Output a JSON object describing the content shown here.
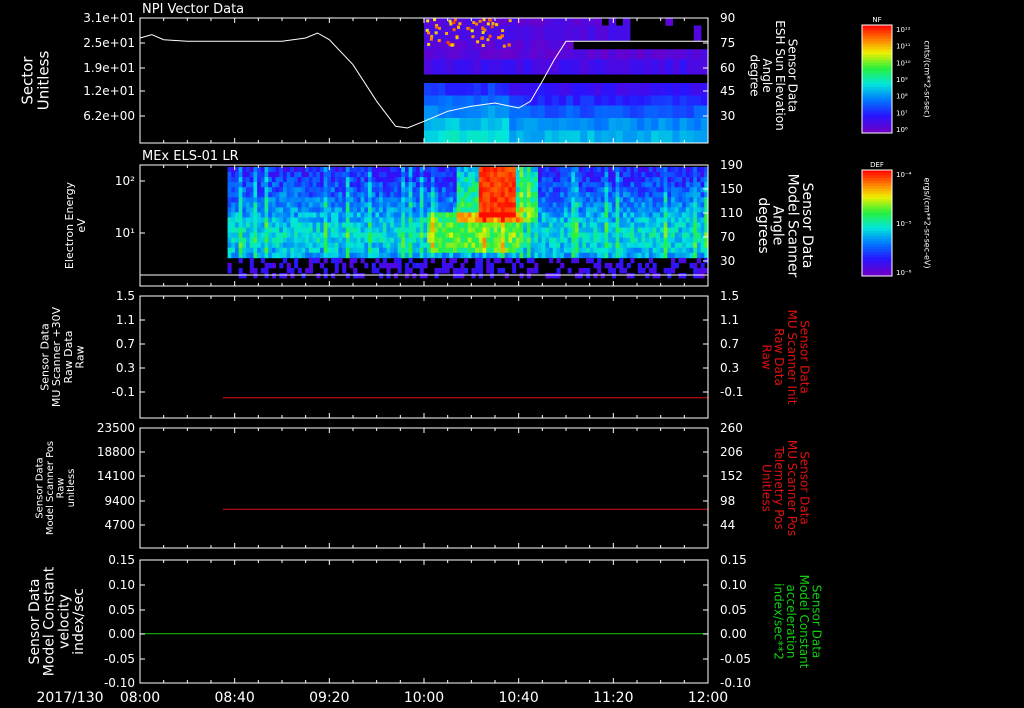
{
  "date_label": "2017/130",
  "time_ticks": [
    "08:00",
    "08:40",
    "09:20",
    "10:00",
    "10:40",
    "11:20",
    "12:00"
  ],
  "colors": {
    "trace_red": "#e01010",
    "trace_green": "#10d010",
    "frame": "#ffffff"
  },
  "chart_data": [
    {
      "type": "heatmap",
      "title": "NPI Vector Data",
      "ylabel": "Sector\nUnitless",
      "yticks": [
        "3.1e+01",
        "2.5e+01",
        "1.9e+01",
        "1.2e+01",
        "6.2e+00"
      ],
      "right_ylabel": "Sensor Data\nESH Sun Elevation\nAngle\ndegree",
      "right_yticks": [
        "90",
        "75",
        "60",
        "45",
        "30"
      ],
      "right_ylim": [
        15,
        90
      ],
      "colorbar": {
        "label": "NF",
        "units": "cnts/(cm**2-sr-sec)",
        "ticks": [
          "10¹²",
          "10¹¹",
          "10¹⁰",
          "10⁹",
          "10⁸",
          "10⁷",
          "10⁶"
        ]
      },
      "data_start": "10:00",
      "overlay_line": {
        "name": "ESH Sun Elevation Angle",
        "x": [
          "08:00",
          "08:05",
          "08:10",
          "08:20",
          "09:00",
          "09:10",
          "09:15",
          "09:20",
          "09:30",
          "09:40",
          "09:48",
          "09:53",
          "10:00",
          "10:10",
          "10:20",
          "10:30",
          "10:40",
          "10:45",
          "10:50",
          "10:55",
          "11:00",
          "11:20",
          "12:00"
        ],
        "y": [
          78,
          80,
          77,
          76,
          76,
          78,
          81,
          77,
          62,
          40,
          25,
          24,
          28,
          34,
          37,
          39,
          36,
          40,
          52,
          65,
          76,
          76,
          76
        ]
      }
    },
    {
      "type": "heatmap",
      "title": "MEx ELS-01 LR",
      "ylabel": "Electron Energy\neV",
      "yticks": [
        "10²",
        "10¹"
      ],
      "right_ylabel": "Sensor Data\nModel Scanner\nAngle\ndegrees",
      "right_yticks": [
        "190",
        "150",
        "110",
        "70",
        "30"
      ],
      "colorbar": {
        "label": "DEF",
        "units": "ergs/(cm**2-sr-sec-eV)",
        "ticks": [
          "10⁻⁴",
          "10⁻⁵",
          "10⁻⁶"
        ]
      },
      "data_start": "08:37",
      "overlay_line": {
        "name": "Model Scanner Angle",
        "x": [
          "08:00",
          "12:00"
        ],
        "y": [
          10,
          10
        ]
      }
    },
    {
      "type": "line",
      "ylabel": "Sensor Data\nMU Scanner +30V\nRaw Data\nRaw",
      "yticks": [
        "1.5",
        "1.1",
        "0.7",
        "0.3",
        "-0.1"
      ],
      "ylim": [
        -0.3,
        1.5
      ],
      "right_ylabel": "Sensor Data\nMU Scanner Init\nRaw Data\nRaw",
      "right_yticks": [
        "1.5",
        "1.1",
        "0.7",
        "0.3",
        "-0.1"
      ],
      "series": [
        {
          "x": [
            "08:35",
            "12:00"
          ],
          "y": [
            0.0,
            0.0
          ]
        }
      ]
    },
    {
      "type": "line",
      "ylabel": "Sensor Data\nModel Scanner Pos\nRaw\nunitless",
      "yticks": [
        "23500",
        "18800",
        "14100",
        "9400",
        "4700"
      ],
      "ylim": [
        0,
        23500
      ],
      "right_ylabel": "Sensor Data\nMU Scanner Pos\nTelemetry Pos\nUnitless",
      "right_yticks": [
        "260",
        "206",
        "152",
        "98",
        "44"
      ],
      "series": [
        {
          "x": [
            "08:35",
            "12:00"
          ],
          "y": [
            7600,
            7600
          ]
        }
      ]
    },
    {
      "type": "line",
      "ylabel": "Sensor Data\nModel Constant\nvelocity\nindex/sec",
      "yticks": [
        "0.15",
        "0.10",
        "0.05",
        "0.00",
        "-0.05",
        "-0.10"
      ],
      "ylim": [
        -0.1,
        0.15
      ],
      "right_ylabel": "Sensor Data\nModel Constant\nacceleration\nindex/sec**2",
      "right_yticks": [
        "0.15",
        "0.10",
        "0.05",
        "0.00",
        "-0.05",
        "-0.10"
      ],
      "series": [
        {
          "x": [
            "08:00",
            "12:00"
          ],
          "y": [
            0.0,
            0.0
          ]
        }
      ]
    }
  ]
}
